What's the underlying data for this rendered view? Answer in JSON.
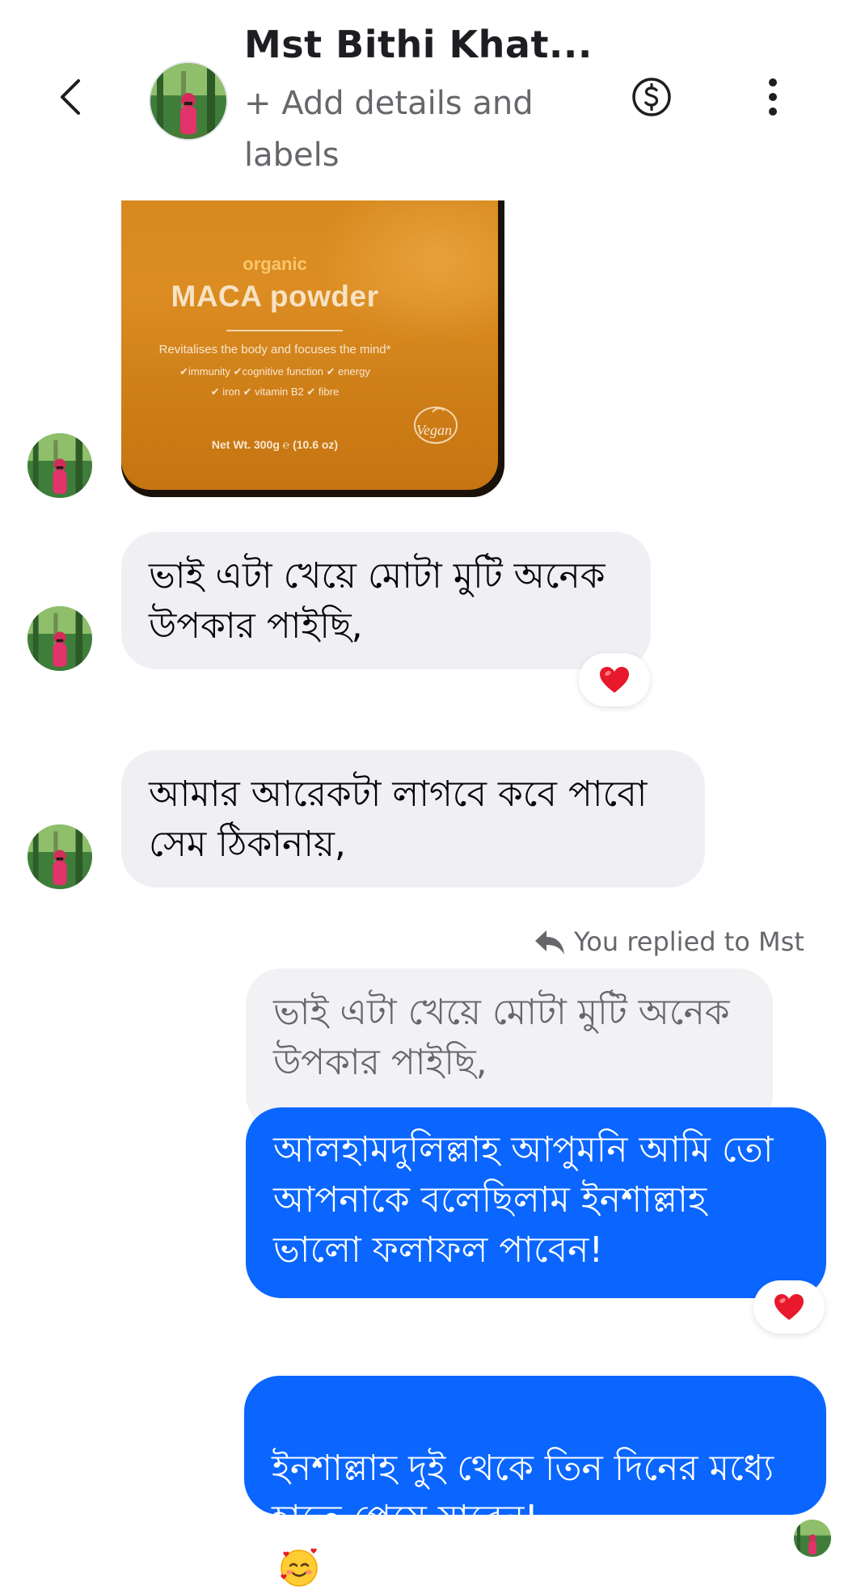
{
  "header": {
    "back_icon": "chevron-left-icon",
    "contact_name": "Mst Bithi Khat...",
    "add_details": "+ Add details and labels",
    "dollar_icon": "dollar-circle-icon",
    "more_icon": "vertical-dots-icon"
  },
  "product_image": {
    "organic": "organic",
    "title": "MACA powder",
    "subtitle": "Revitalises the body and focuses the mind*",
    "benefits_line1": "✔immunity ✔cognitive function ✔ energy",
    "benefits_line2": "✔ iron ✔ vitamin B2 ✔ fibre",
    "net_weight": "Net Wt. 300g ℮ (10.6 oz)",
    "vegan": "Vegan"
  },
  "messages": {
    "incoming_1": "ভাই এটা খেয়ে মোটা মুটি অনেক\nউপকার পাইছি,",
    "incoming_2": "আমার আরেকটা লাগবে কবে পাবো\nসেম ঠিকানায়,",
    "replied_label": "You replied to Mst",
    "quoted_text": "ভাই এটা খেয়ে মোটা মুটি অনেক\nউপকার পাইছি,",
    "outgoing_1": "আলহামদুলিল্লাহ আপুমনি আমি তো\nআপনাকে বলেছিলাম ইনশাল্লাহ\nভালো ফলাফল পাবেন!",
    "outgoing_2": "ইনশাল্লাহ দুই থেকে তিন দিনের মধ্যে\nহাতে পেয়ে যাবেন!",
    "outgoing_2_emoji": "smiling-face-with-hearts-icon",
    "reaction_icon": "red-heart-icon"
  },
  "colors": {
    "outgoing_bubble": "#0a66ff",
    "incoming_bubble": "#f0f0f4",
    "secondary_text": "#65676b",
    "heart": "#e8192c"
  }
}
